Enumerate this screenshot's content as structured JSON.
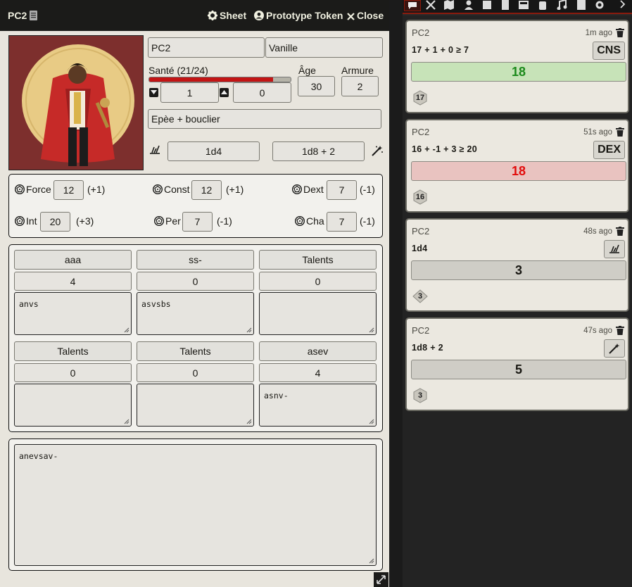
{
  "window": {
    "title": "PC2",
    "buttons": {
      "sheet": "Sheet",
      "prototype": "Prototype Token",
      "close": "Close"
    }
  },
  "character": {
    "name": "PC2",
    "class": "Vanille",
    "health_label": "Santé (21/24)",
    "health_fraction": 0.875,
    "stepper_down_value": "1",
    "stepper_up_value": "0",
    "age_label": "Âge",
    "age": "30",
    "armor_label": "Armure",
    "armor": "2",
    "weapon": "Epèe + bouclier",
    "dmg_melee": "1d4",
    "dmg_magic": "1d8 + 2"
  },
  "stats": [
    {
      "label": "Force",
      "value": "12",
      "mod": "(+1)"
    },
    {
      "label": "Const",
      "value": "12",
      "mod": "(+1)"
    },
    {
      "label": "Dext",
      "value": "7",
      "mod": "(-1)"
    },
    {
      "label": "Int",
      "value": "20",
      "mod": "(+3)"
    },
    {
      "label": "Per",
      "value": "7",
      "mod": "(-1)"
    },
    {
      "label": "Cha",
      "value": "7",
      "mod": "(-1)"
    }
  ],
  "skills": [
    {
      "title": "aaa",
      "value": "4",
      "notes": "anvs"
    },
    {
      "title": "ss-",
      "value": "0",
      "notes": "asvsbs"
    },
    {
      "title": "Talents",
      "value": "0",
      "notes": ""
    },
    {
      "title": "Talents",
      "value": "0",
      "notes": ""
    },
    {
      "title": "Talents",
      "value": "0",
      "notes": ""
    },
    {
      "title": "asev",
      "value": "4",
      "notes": "asnv-"
    }
  ],
  "notes": "anevsav-",
  "chat": [
    {
      "speaker": "PC2",
      "time": "1m ago",
      "formula": "17 + 1 + 0 ≥ 7",
      "tag": "CNS",
      "result": "18",
      "status": "success",
      "die": "17",
      "die_type": "d20"
    },
    {
      "speaker": "PC2",
      "time": "51s ago",
      "formula": "16 + -1 + 3 ≥ 20",
      "tag": "DEX",
      "result": "18",
      "status": "failure",
      "die": "16",
      "die_type": "d20"
    },
    {
      "speaker": "PC2",
      "time": "48s ago",
      "formula": "1d4",
      "tag_icon": "slash-icon",
      "result": "3",
      "status": "neutral",
      "die": "3",
      "die_type": "d4"
    },
    {
      "speaker": "PC2",
      "time": "47s ago",
      "formula": "1d8 + 2",
      "tag_icon": "wand-icon",
      "result": "5",
      "status": "neutral",
      "die": "3",
      "die_type": "d8"
    }
  ],
  "colors": {
    "success_bg": "#c7e3b8",
    "success_text": "#1b8a1b",
    "failure_bg": "#e9c3c0",
    "failure_text": "#e20b0b",
    "accent": "#8b1a0c",
    "health": "#c31414"
  }
}
